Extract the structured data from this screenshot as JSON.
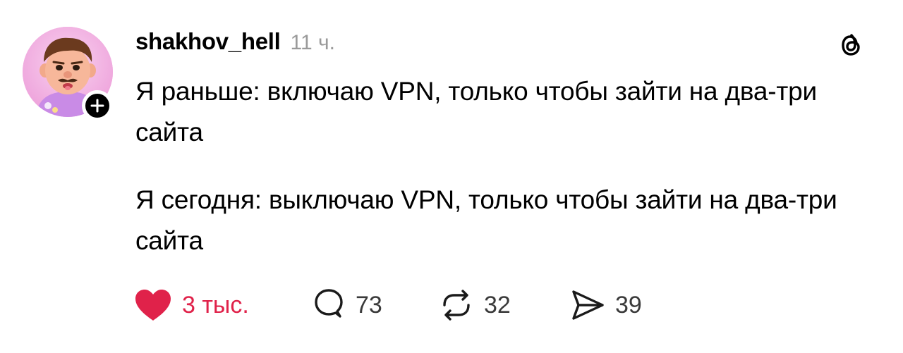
{
  "post": {
    "username": "shakhov_hell",
    "timestamp": "11 ч.",
    "paragraphs": [
      "Я раньше: включаю VPN, только чтобы зайти на два-три сайта",
      "Я сегодня: выключаю VPN, только чтобы зайти на два-три сайта"
    ]
  },
  "actions": {
    "likes": "3 тыс.",
    "comments": "73",
    "reposts": "32",
    "shares": "39"
  },
  "icons": {
    "like": "heart-icon",
    "comment": "comment-bubble-icon",
    "repost": "repost-icon",
    "share": "send-icon",
    "brand": "threads-logo-icon",
    "follow": "plus-icon"
  },
  "colors": {
    "like_active": "#e0224a",
    "text": "#000000",
    "meta": "#9a9a9a",
    "avatar_bg": "#f4b6e6"
  }
}
